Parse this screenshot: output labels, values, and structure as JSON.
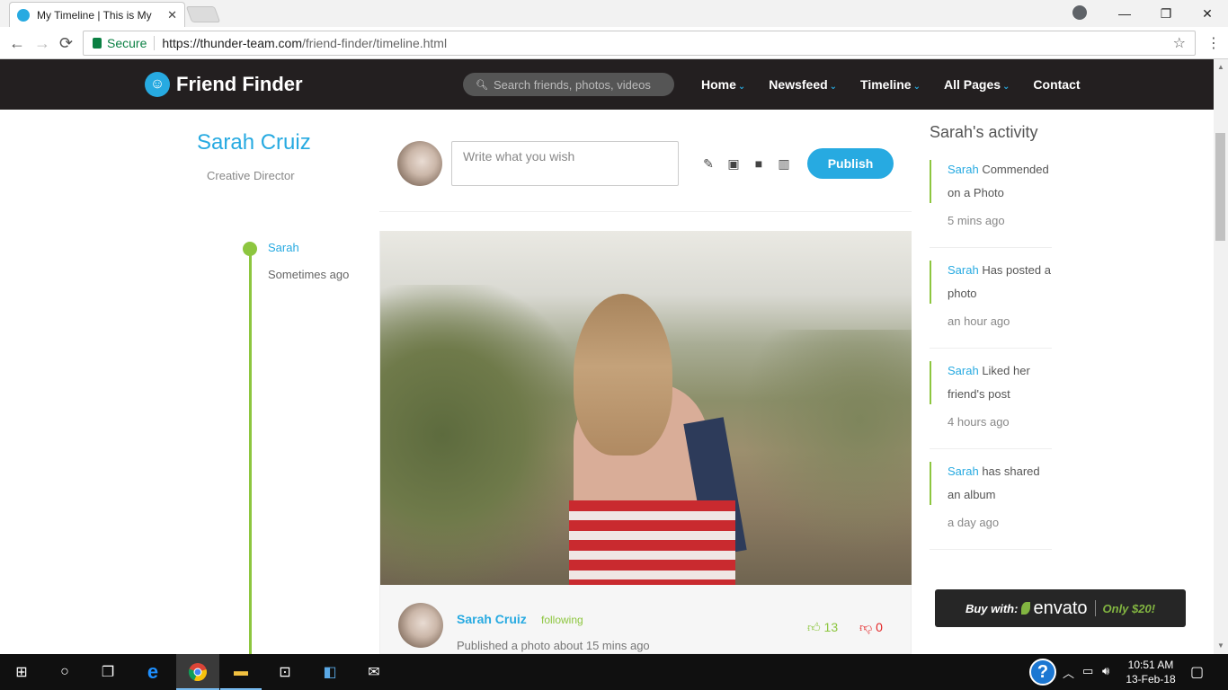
{
  "browser": {
    "tab_title": "My Timeline | This is My",
    "tab_close": "✕",
    "back": "←",
    "forward": "→",
    "reload": "⟳",
    "secure_label": "Secure",
    "url_host": "https://thunder-team.com",
    "url_path": "/friend-finder/timeline.html",
    "star": "☆",
    "menu": "⋮",
    "minimize": "—",
    "restore": "❐",
    "close": "✕"
  },
  "site": {
    "logo_text": "Friend Finder",
    "search_placeholder": "Search friends, photos, videos",
    "nav": [
      {
        "label": "Home",
        "chevron": "⌄"
      },
      {
        "label": "Newsfeed",
        "chevron": "⌄"
      },
      {
        "label": "Timeline",
        "chevron": "⌄"
      },
      {
        "label": "All Pages",
        "chevron": "⌄"
      },
      {
        "label": "Contact"
      }
    ],
    "accent": "#27aae1",
    "green": "#8dc63f",
    "header_bg": "#231f20"
  },
  "profile": {
    "name": "Sarah Cruiz",
    "role": "Creative Director"
  },
  "timeline": {
    "name": "Sarah",
    "time": "Sometimes ago"
  },
  "composer": {
    "placeholder": "Write what you wish",
    "publish": "Publish",
    "tools": [
      "edit-icon",
      "image-icon",
      "video-icon",
      "map-icon"
    ]
  },
  "post": {
    "author": "Sarah Cruiz",
    "following": "following",
    "meta": "Published a photo about 15 mins ago",
    "likes": "13",
    "dislikes": "0"
  },
  "activity": {
    "title": "Sarah's activity",
    "items": [
      {
        "who": "Sarah",
        "text": " Commended on a Photo",
        "when": "5 mins ago"
      },
      {
        "who": "Sarah",
        "text": " Has posted a photo",
        "when": "an hour ago"
      },
      {
        "who": "Sarah",
        "text": " Liked her friend's post",
        "when": "4 hours ago"
      },
      {
        "who": "Sarah",
        "text": " has shared an album",
        "when": "a day ago"
      }
    ]
  },
  "envato": {
    "buy_with": "Buy with:",
    "brand": "envato",
    "price": "Only $20!"
  },
  "taskbar": {
    "time": "10:51 AM",
    "date": "13-Feb-18",
    "help": "?"
  }
}
